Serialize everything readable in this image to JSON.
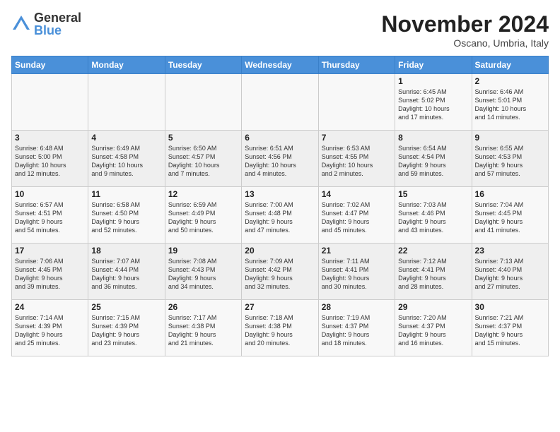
{
  "logo": {
    "general": "General",
    "blue": "Blue"
  },
  "title": "November 2024",
  "subtitle": "Oscano, Umbria, Italy",
  "days_of_week": [
    "Sunday",
    "Monday",
    "Tuesday",
    "Wednesday",
    "Thursday",
    "Friday",
    "Saturday"
  ],
  "weeks": [
    [
      {
        "day": "",
        "info": ""
      },
      {
        "day": "",
        "info": ""
      },
      {
        "day": "",
        "info": ""
      },
      {
        "day": "",
        "info": ""
      },
      {
        "day": "",
        "info": ""
      },
      {
        "day": "1",
        "info": "Sunrise: 6:45 AM\nSunset: 5:02 PM\nDaylight: 10 hours\nand 17 minutes."
      },
      {
        "day": "2",
        "info": "Sunrise: 6:46 AM\nSunset: 5:01 PM\nDaylight: 10 hours\nand 14 minutes."
      }
    ],
    [
      {
        "day": "3",
        "info": "Sunrise: 6:48 AM\nSunset: 5:00 PM\nDaylight: 10 hours\nand 12 minutes."
      },
      {
        "day": "4",
        "info": "Sunrise: 6:49 AM\nSunset: 4:58 PM\nDaylight: 10 hours\nand 9 minutes."
      },
      {
        "day": "5",
        "info": "Sunrise: 6:50 AM\nSunset: 4:57 PM\nDaylight: 10 hours\nand 7 minutes."
      },
      {
        "day": "6",
        "info": "Sunrise: 6:51 AM\nSunset: 4:56 PM\nDaylight: 10 hours\nand 4 minutes."
      },
      {
        "day": "7",
        "info": "Sunrise: 6:53 AM\nSunset: 4:55 PM\nDaylight: 10 hours\nand 2 minutes."
      },
      {
        "day": "8",
        "info": "Sunrise: 6:54 AM\nSunset: 4:54 PM\nDaylight: 9 hours\nand 59 minutes."
      },
      {
        "day": "9",
        "info": "Sunrise: 6:55 AM\nSunset: 4:53 PM\nDaylight: 9 hours\nand 57 minutes."
      }
    ],
    [
      {
        "day": "10",
        "info": "Sunrise: 6:57 AM\nSunset: 4:51 PM\nDaylight: 9 hours\nand 54 minutes."
      },
      {
        "day": "11",
        "info": "Sunrise: 6:58 AM\nSunset: 4:50 PM\nDaylight: 9 hours\nand 52 minutes."
      },
      {
        "day": "12",
        "info": "Sunrise: 6:59 AM\nSunset: 4:49 PM\nDaylight: 9 hours\nand 50 minutes."
      },
      {
        "day": "13",
        "info": "Sunrise: 7:00 AM\nSunset: 4:48 PM\nDaylight: 9 hours\nand 47 minutes."
      },
      {
        "day": "14",
        "info": "Sunrise: 7:02 AM\nSunset: 4:47 PM\nDaylight: 9 hours\nand 45 minutes."
      },
      {
        "day": "15",
        "info": "Sunrise: 7:03 AM\nSunset: 4:46 PM\nDaylight: 9 hours\nand 43 minutes."
      },
      {
        "day": "16",
        "info": "Sunrise: 7:04 AM\nSunset: 4:45 PM\nDaylight: 9 hours\nand 41 minutes."
      }
    ],
    [
      {
        "day": "17",
        "info": "Sunrise: 7:06 AM\nSunset: 4:45 PM\nDaylight: 9 hours\nand 39 minutes."
      },
      {
        "day": "18",
        "info": "Sunrise: 7:07 AM\nSunset: 4:44 PM\nDaylight: 9 hours\nand 36 minutes."
      },
      {
        "day": "19",
        "info": "Sunrise: 7:08 AM\nSunset: 4:43 PM\nDaylight: 9 hours\nand 34 minutes."
      },
      {
        "day": "20",
        "info": "Sunrise: 7:09 AM\nSunset: 4:42 PM\nDaylight: 9 hours\nand 32 minutes."
      },
      {
        "day": "21",
        "info": "Sunrise: 7:11 AM\nSunset: 4:41 PM\nDaylight: 9 hours\nand 30 minutes."
      },
      {
        "day": "22",
        "info": "Sunrise: 7:12 AM\nSunset: 4:41 PM\nDaylight: 9 hours\nand 28 minutes."
      },
      {
        "day": "23",
        "info": "Sunrise: 7:13 AM\nSunset: 4:40 PM\nDaylight: 9 hours\nand 27 minutes."
      }
    ],
    [
      {
        "day": "24",
        "info": "Sunrise: 7:14 AM\nSunset: 4:39 PM\nDaylight: 9 hours\nand 25 minutes."
      },
      {
        "day": "25",
        "info": "Sunrise: 7:15 AM\nSunset: 4:39 PM\nDaylight: 9 hours\nand 23 minutes."
      },
      {
        "day": "26",
        "info": "Sunrise: 7:17 AM\nSunset: 4:38 PM\nDaylight: 9 hours\nand 21 minutes."
      },
      {
        "day": "27",
        "info": "Sunrise: 7:18 AM\nSunset: 4:38 PM\nDaylight: 9 hours\nand 20 minutes."
      },
      {
        "day": "28",
        "info": "Sunrise: 7:19 AM\nSunset: 4:37 PM\nDaylight: 9 hours\nand 18 minutes."
      },
      {
        "day": "29",
        "info": "Sunrise: 7:20 AM\nSunset: 4:37 PM\nDaylight: 9 hours\nand 16 minutes."
      },
      {
        "day": "30",
        "info": "Sunrise: 7:21 AM\nSunset: 4:37 PM\nDaylight: 9 hours\nand 15 minutes."
      }
    ]
  ]
}
